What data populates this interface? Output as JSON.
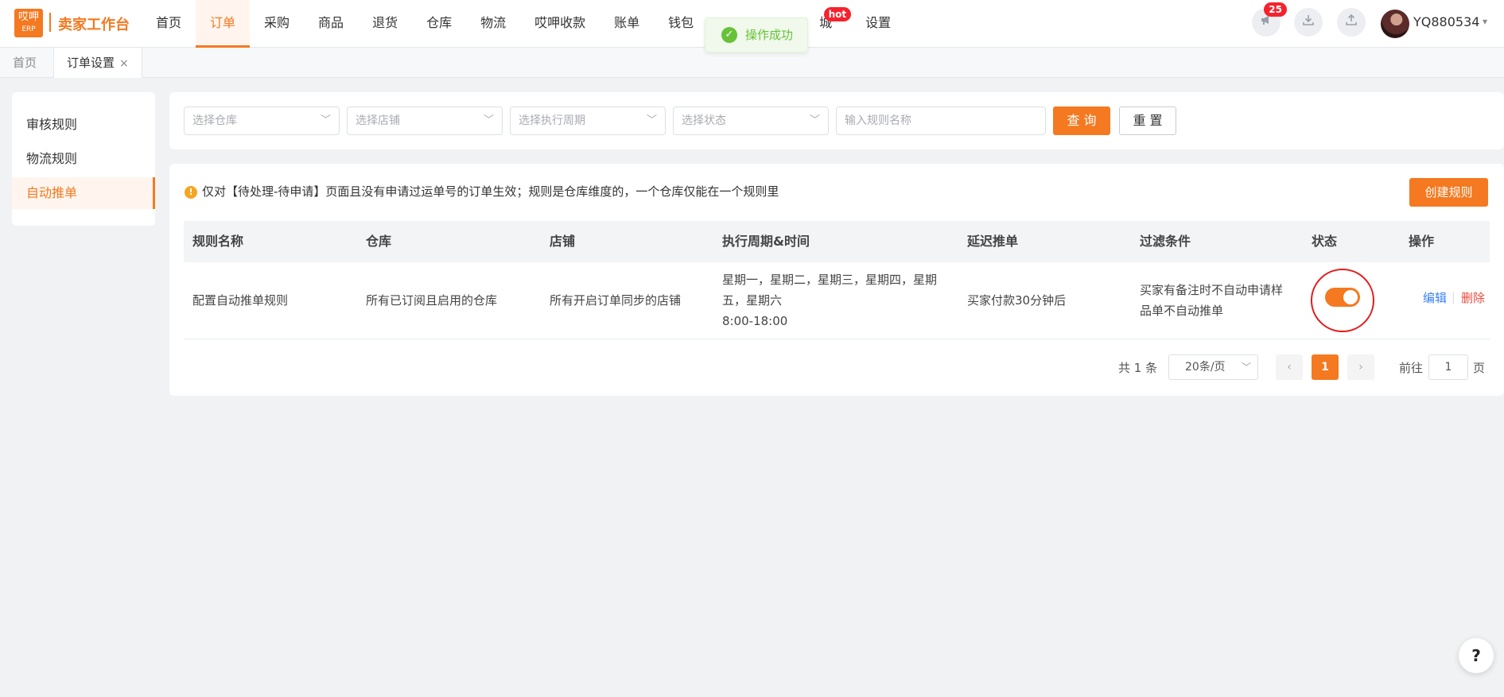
{
  "header": {
    "logo_top": "哎呷",
    "logo_bottom": "ERP",
    "brand": "卖家工作台",
    "nav": [
      "首页",
      "订单",
      "采购",
      "商品",
      "退货",
      "仓库",
      "物流",
      "哎呷收款",
      "账单",
      "钱包",
      "城",
      "设置"
    ],
    "active_nav": "订单",
    "hot_badge": "hot",
    "notification_count": "25",
    "username": "YQ880534",
    "icons": [
      "megaphone-icon",
      "download-icon",
      "upload-icon",
      "avatar",
      "chevron-down-icon"
    ]
  },
  "toast": {
    "text": "操作成功",
    "icon": "check-circle-icon",
    "color": "#67c23a"
  },
  "tabs": [
    {
      "label": "首页"
    },
    {
      "label": "订单设置",
      "close": "×"
    }
  ],
  "sidebar": {
    "items": [
      {
        "label": "审核规则"
      },
      {
        "label": "物流规则"
      },
      {
        "label": "自动推单"
      }
    ],
    "active": "自动推单"
  },
  "filters": {
    "warehouse_placeholder": "选择仓库",
    "shop_placeholder": "选择店铺",
    "cycle_placeholder": "选择执行周期",
    "status_placeholder": "选择状态",
    "rule_name_placeholder": "输入规则名称",
    "query_label": "查 询",
    "reset_label": "重 置"
  },
  "main": {
    "notice": "仅对【待处理-待申请】页面且没有申请过运单号的订单生效；规则是仓库维度的，一个仓库仅能在一个规则里",
    "create_label": "创建规则"
  },
  "table": {
    "columns": [
      "规则名称",
      "仓库",
      "店铺",
      "执行周期&时间",
      "延迟推单",
      "过滤条件",
      "状态",
      "操作"
    ],
    "rows": [
      {
        "name": "配置自动推单规则",
        "warehouse": "所有已订阅且启用的仓库",
        "shop": "所有开启订单同步的店铺",
        "cycle_days": "星期一，星期二，星期三，星期四，星期五，星期六",
        "cycle_time": "8:00-18:00",
        "delay": "买家付款30分钟后",
        "filter": "买家有备注时不自动申请样品单不自动推单",
        "status_on": true,
        "edit_label": "编辑",
        "sep": "|",
        "delete_label": "删除"
      }
    ]
  },
  "pagination": {
    "total": "共 1 条",
    "page_size": "20条/页",
    "prev": "‹",
    "current": "1",
    "next": "›",
    "goto_label": "前往",
    "goto_value": "1",
    "page_label": "页"
  },
  "help_label": "?",
  "colors": {
    "accent": "#f47920",
    "link": "#3b82f6",
    "danger": "#e84c3d",
    "highlight_ring": "#e31b1b"
  }
}
